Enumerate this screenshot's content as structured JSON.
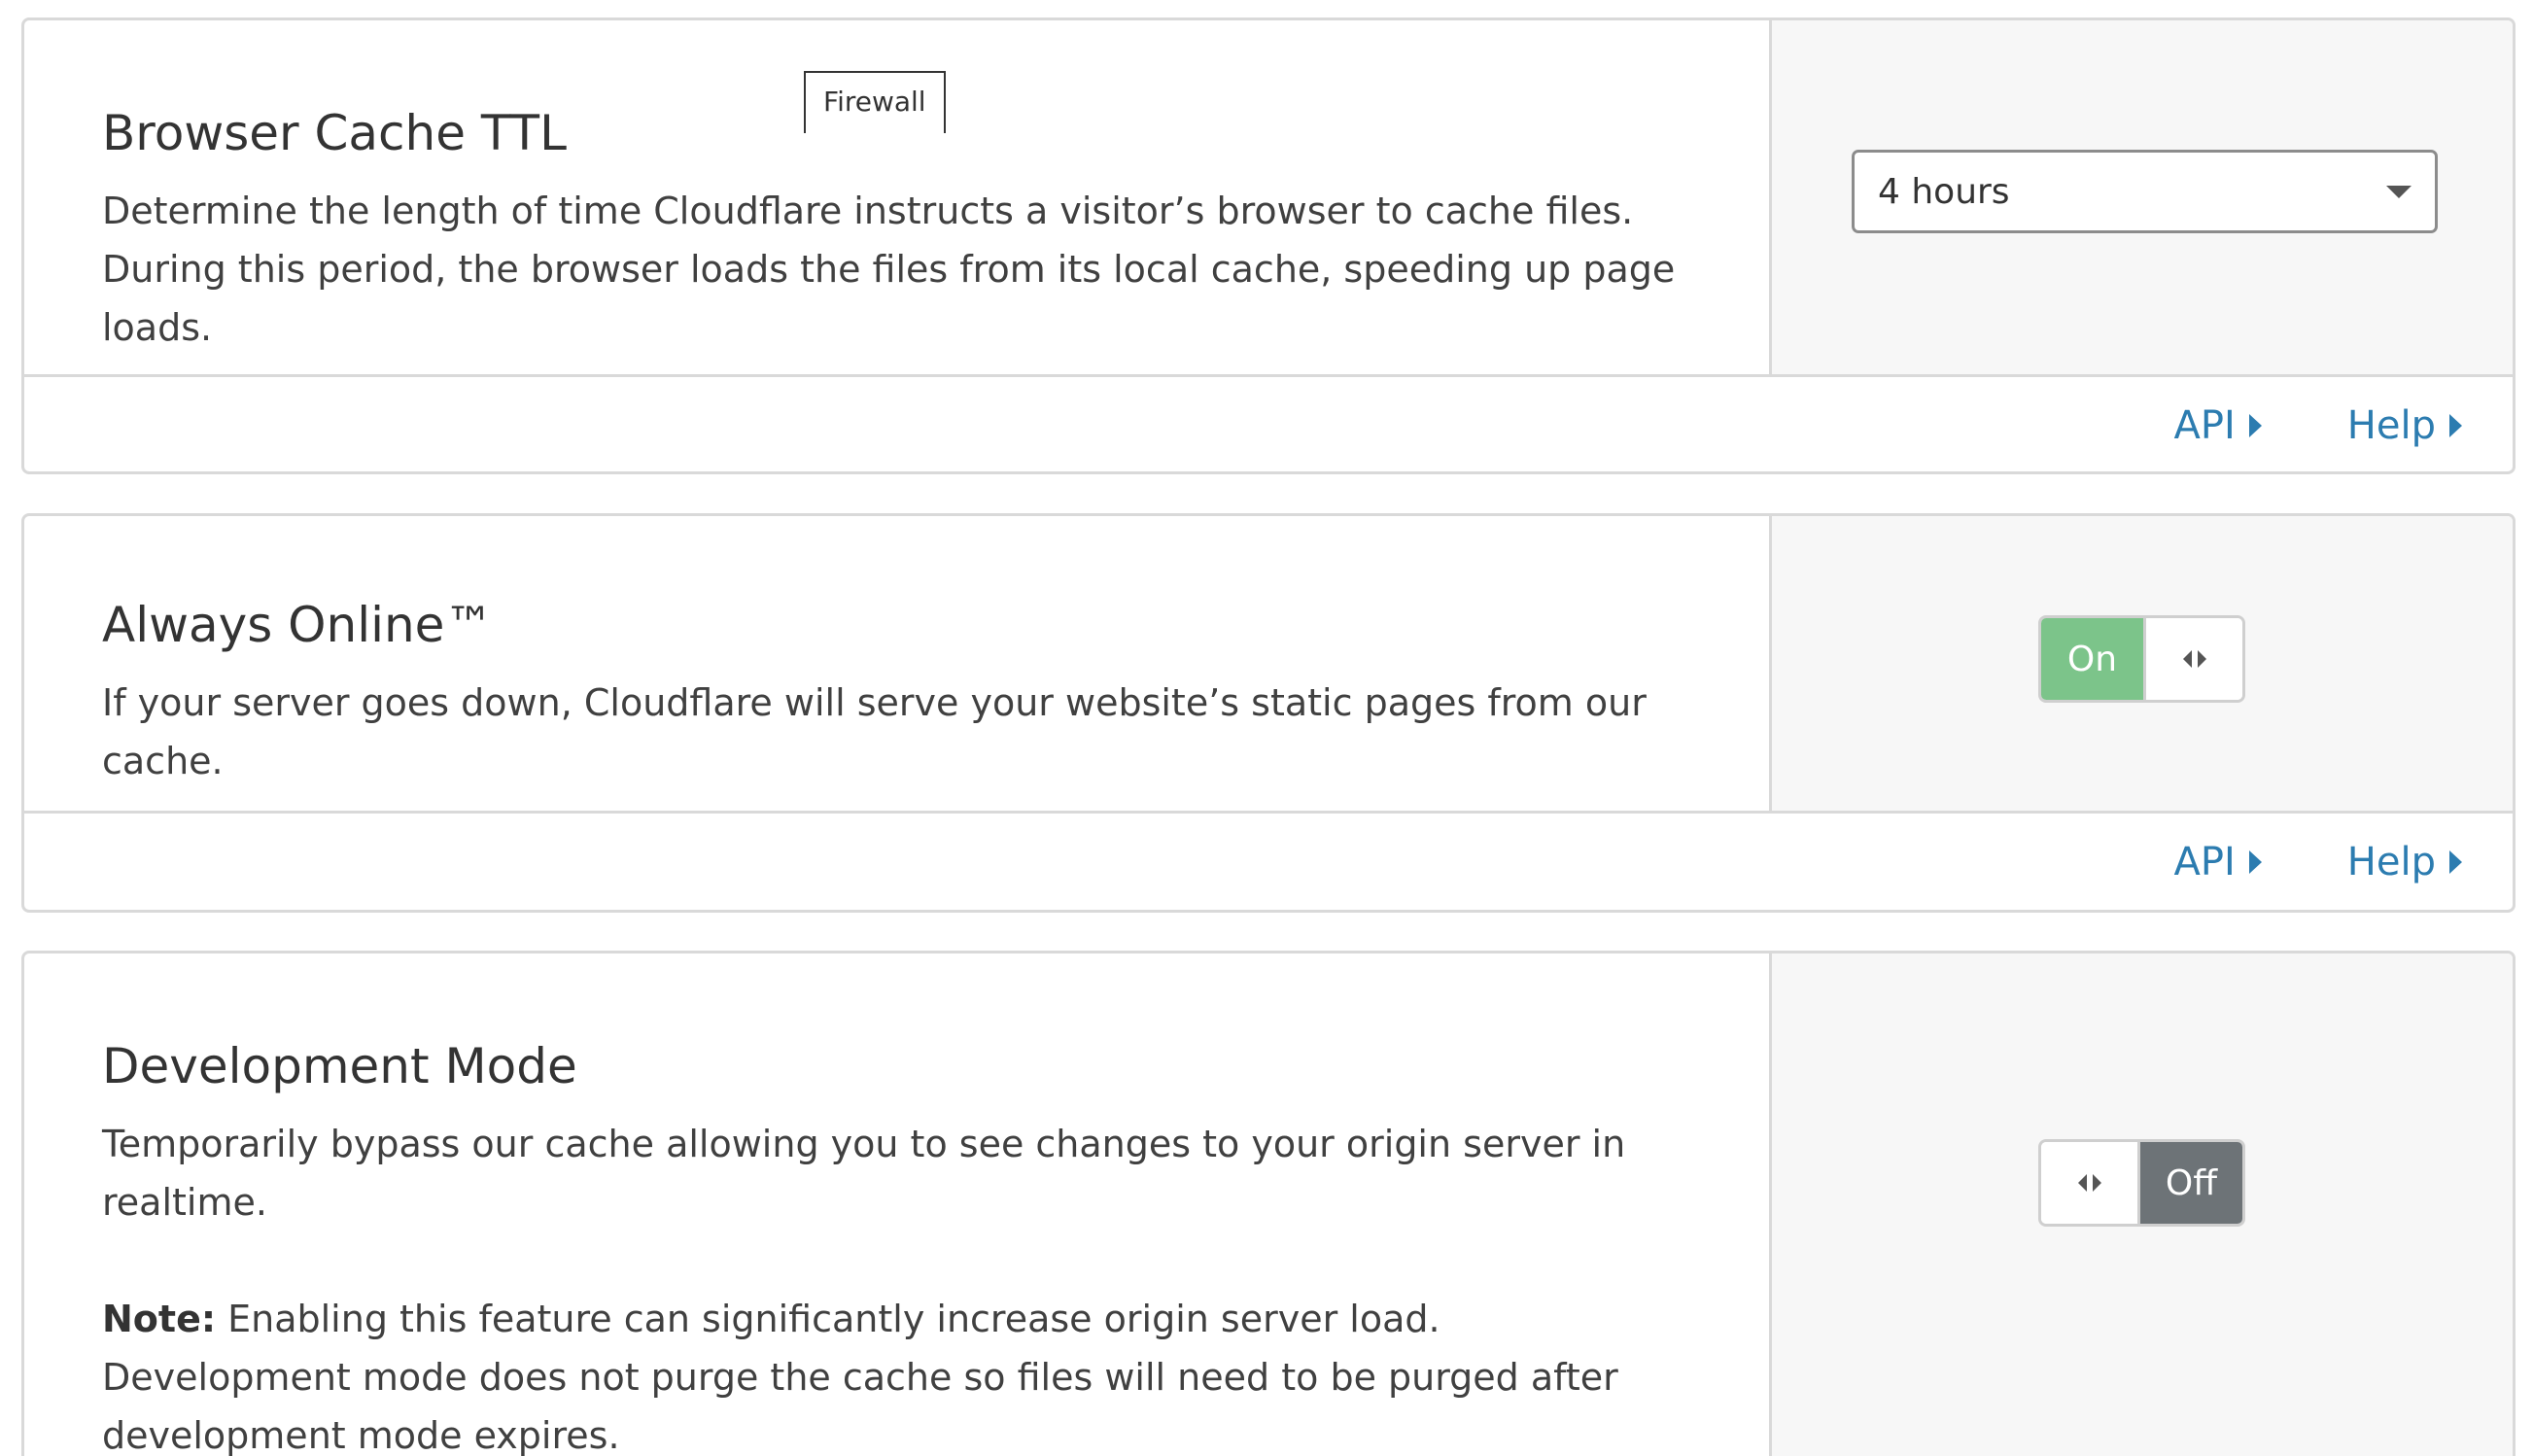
{
  "tag": {
    "label": "Firewall"
  },
  "browser_cache": {
    "title": "Browser Cache TTL",
    "description": "Determine the length of time Cloudflare instructs a visitor’s browser to cache files. During this period, the browser loads the files from its local cache, speeding up page loads.",
    "select_value": "4 hours",
    "api_label": "API",
    "help_label": "Help"
  },
  "always_online": {
    "title": "Always Online™",
    "description": "If your server goes down, Cloudflare will serve your website’s static pages from our cache.",
    "toggle_label": "On",
    "api_label": "API",
    "help_label": "Help"
  },
  "dev_mode": {
    "title": "Development Mode",
    "description": "Temporarily bypass our cache allowing you to see changes to your origin server in realtime.",
    "note_label": "Note:",
    "note_text": " Enabling this feature can significantly increase origin server load. Development mode does not purge the cache so files will need to be purged after development mode expires.",
    "toggle_label": "Off"
  },
  "colors": {
    "link": "#2c7cb0",
    "toggle_on": "#7cc48a",
    "toggle_off": "#6d7377",
    "border": "#d9d9d9",
    "side_bg": "#f7f7f7"
  }
}
